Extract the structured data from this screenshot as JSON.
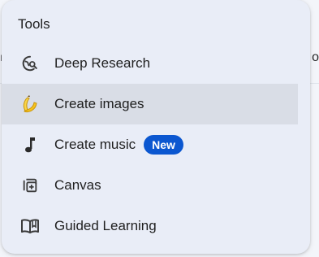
{
  "menu": {
    "title": "Tools",
    "items": [
      {
        "label": "Deep Research",
        "icon": "deep-research-icon"
      },
      {
        "label": "Create images",
        "icon": "banana-icon",
        "selected": true
      },
      {
        "label": "Create music",
        "icon": "music-note-icon",
        "badge": "New"
      },
      {
        "label": "Canvas",
        "icon": "canvas-icon"
      },
      {
        "label": "Guided Learning",
        "icon": "book-icon"
      }
    ]
  },
  "colors": {
    "menu_bg": "#e9edf7",
    "selected_bg": "#d9dde6",
    "badge_bg": "#0b57d0",
    "text": "#1f1f1f"
  }
}
